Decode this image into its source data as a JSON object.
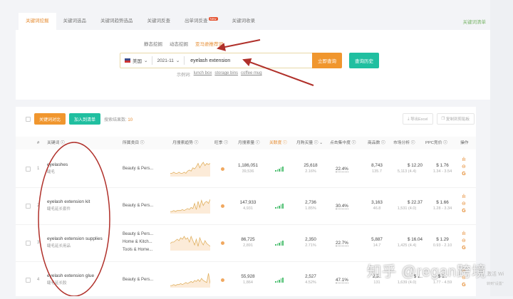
{
  "tabs": [
    {
      "label": "关键词挖掘",
      "active": true
    },
    {
      "label": "关键词选品"
    },
    {
      "label": "关键词趋势选品"
    },
    {
      "label": "关键词反查"
    },
    {
      "label": "出单词反查",
      "badge": "New"
    },
    {
      "label": "关键词收录"
    }
  ],
  "tab_right": "关键词清单",
  "subtabs": [
    {
      "label": "静态挖掘"
    },
    {
      "label": "动态挖掘"
    },
    {
      "label": "亚马逊推荐词",
      "active": true
    }
  ],
  "search": {
    "country": "美国",
    "month": "2021-11",
    "keyword": "eyelash extension",
    "submit": "立即查询",
    "history": "查询历史",
    "examples_label": "示例词:",
    "examples": [
      "lunch box",
      "storage bins",
      "coffee mug"
    ]
  },
  "toolbar": {
    "compare": "关键词对比",
    "add_list": "加入到清单",
    "count_label": "搜索结果数:",
    "count": "10",
    "export": "导出Excel",
    "copy": "复制到剪贴板"
  },
  "headers": [
    "#",
    "关键词 ⓘ",
    "所属类目 ⓘ",
    "月搜索趋势 ⓘ",
    "旺季 ⓘ",
    "月搜索量 ⓘ",
    "关联度 ⓘ",
    "月购买量 ⓘ ⌄",
    "点击集中度 ⓘ",
    "商品数 ⓘ",
    "市场分析 ⓘ",
    "PPC竞价 ⓘ",
    "操作"
  ],
  "rows": [
    {
      "idx": "1",
      "kw": "eyelashes",
      "zh": "睫毛",
      "cats": [
        "Beauty & Pers..."
      ],
      "search": "1,186,051",
      "search_sub": "39,536",
      "buy": "25,618",
      "buy_sub": "2.16%",
      "click": "22.4%",
      "goods": "8,743",
      "goods_sub": "135.7",
      "market": "$ 12.20",
      "market_sub": "5,113 (4.4)",
      "ppc": "$ 1.76",
      "ppc_sub": "1.34 - 3.54",
      "trend": [
        3,
        3,
        4,
        3,
        3,
        4,
        3,
        3,
        4,
        3,
        5,
        6,
        5,
        8,
        7,
        9,
        12,
        8,
        11,
        13,
        10,
        12,
        11,
        12
      ]
    },
    {
      "idx": "2",
      "kw": "eyelash extension kit",
      "zh": "睫毛延长套件",
      "cats": [
        "Beauty & Pers..."
      ],
      "search": "147,933",
      "search_sub": "4,931",
      "buy": "2,736",
      "buy_sub": "1.85%",
      "click": "30.4%",
      "goods": "3,163",
      "goods_sub": "46.8",
      "market": "$ 22.37",
      "market_sub": "1,531 (4.0)",
      "ppc": "$ 1.66",
      "ppc_sub": "1.28 - 3.34",
      "trend": [
        2,
        2,
        3,
        2,
        3,
        3,
        3,
        4,
        3,
        4,
        5,
        4,
        6,
        5,
        10,
        4,
        12,
        6,
        13,
        8,
        11,
        12,
        10,
        14
      ]
    },
    {
      "idx": "3",
      "kw": "eyelash extension supplies",
      "zh": "睫毛延长用品",
      "cats": [
        "Beauty & Pers...",
        "Home & Kitch...",
        "Tools & Home..."
      ],
      "search": "86,725",
      "search_sub": "2,891",
      "buy": "2,350",
      "buy_sub": "2.71%",
      "click": "22.7%",
      "goods": "5,887",
      "goods_sub": "14.7",
      "market": "$ 16.04",
      "market_sub": "1,425 (4.4)",
      "ppc": "$ 1.29",
      "ppc_sub": "0.93 - 2.10",
      "trend": [
        5,
        6,
        6,
        7,
        8,
        7,
        9,
        8,
        10,
        8,
        9,
        6,
        10,
        7,
        4,
        8,
        3,
        9,
        6,
        4,
        7,
        5,
        4,
        3
      ]
    },
    {
      "idx": "4",
      "kw": "eyelash extension glue",
      "zh": "睫毛延长胶",
      "cats": [
        "Beauty & Pers..."
      ],
      "search": "55,928",
      "search_sub": "1,864",
      "buy": "2,527",
      "buy_sub": "4.52%",
      "click": "47.1%",
      "goods": "2,3..",
      "goods_sub": "131",
      "market": "$ 1..",
      "market_sub": "1,639 (4.0)",
      "ppc": "$ 1..",
      "ppc_sub": "1.77 - 4.59",
      "trend": [
        2,
        2,
        3,
        2,
        3,
        3,
        4,
        3,
        4,
        5,
        4,
        5,
        6,
        5,
        7,
        6,
        8,
        6,
        9,
        7,
        6,
        5,
        14,
        4
      ]
    }
  ],
  "watermark": "知乎 @regan跨境",
  "os_notice": [
    "激活 Wi",
    "转到\"设置\""
  ],
  "colors": {
    "accent": "#f0962e",
    "teal": "#20bfa0",
    "annotation": "#b0302a"
  }
}
